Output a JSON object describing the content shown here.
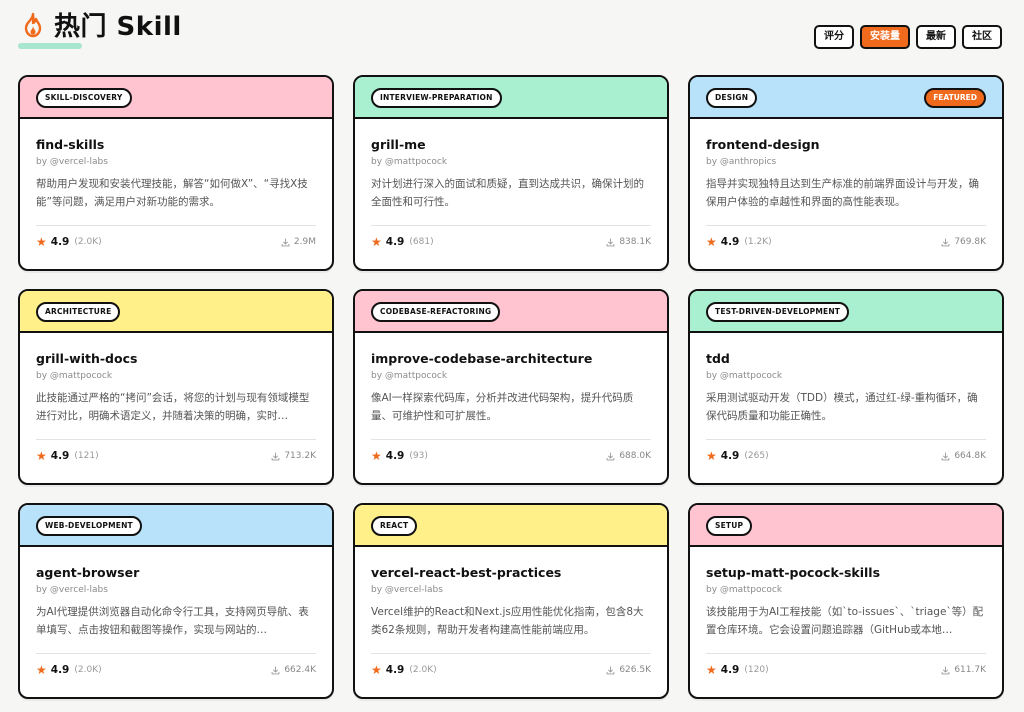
{
  "header": {
    "title": "热门 Skill",
    "sort_options": [
      {
        "label": "评分",
        "active": false
      },
      {
        "label": "安装量",
        "active": true
      },
      {
        "label": "最新",
        "active": false
      },
      {
        "label": "社区",
        "active": false
      }
    ]
  },
  "colors": {
    "accent": "#f06a1d",
    "pink": "#ffc4cf",
    "mint": "#a8f0cf",
    "blue": "#b8e2fa",
    "yellow": "#fff08a"
  },
  "cards": [
    {
      "tag": "SKILL-DISCOVERY",
      "head_color": "#ffc4cf",
      "featured": "",
      "name": "find-skills",
      "author": "by @vercel-labs",
      "desc": "帮助用户发现和安装代理技能，解答“如何做X”、“寻找X技能”等问题，满足用户对新功能的需求。",
      "rating": "4.9",
      "rating_count": "(2.0K)",
      "installs": "2.9M"
    },
    {
      "tag": "INTERVIEW-PREPARATION",
      "head_color": "#a8f0cf",
      "featured": "",
      "name": "grill-me",
      "author": "by @mattpocock",
      "desc": "对计划进行深入的面试和质疑，直到达成共识，确保计划的全面性和可行性。",
      "rating": "4.9",
      "rating_count": "(681)",
      "installs": "838.1K"
    },
    {
      "tag": "DESIGN",
      "head_color": "#b8e2fa",
      "featured": "FEATURED",
      "name": "frontend-design",
      "author": "by @anthropics",
      "desc": "指导并实现独特且达到生产标准的前端界面设计与开发，确保用户体验的卓越性和界面的高性能表现。",
      "rating": "4.9",
      "rating_count": "(1.2K)",
      "installs": "769.8K"
    },
    {
      "tag": "ARCHITECTURE",
      "head_color": "#fff08a",
      "featured": "",
      "name": "grill-with-docs",
      "author": "by @mattpocock",
      "desc": "此技能通过严格的“拷问”会话，将您的计划与现有领域模型进行对比，明确术语定义，并随着决策的明确，实时…",
      "rating": "4.9",
      "rating_count": "(121)",
      "installs": "713.2K"
    },
    {
      "tag": "CODEBASE-REFACTORING",
      "head_color": "#ffc4cf",
      "featured": "",
      "name": "improve-codebase-architecture",
      "author": "by @mattpocock",
      "desc": "像AI一样探索代码库，分析并改进代码架构，提升代码质量、可维护性和可扩展性。",
      "rating": "4.9",
      "rating_count": "(93)",
      "installs": "688.0K"
    },
    {
      "tag": "TEST-DRIVEN-DEVELOPMENT",
      "head_color": "#a8f0cf",
      "featured": "",
      "name": "tdd",
      "author": "by @mattpocock",
      "desc": "采用测试驱动开发（TDD）模式，通过红-绿-重构循环，确保代码质量和功能正确性。",
      "rating": "4.9",
      "rating_count": "(265)",
      "installs": "664.8K"
    },
    {
      "tag": "WEB-DEVELOPMENT",
      "head_color": "#b8e2fa",
      "featured": "",
      "name": "agent-browser",
      "author": "by @vercel-labs",
      "desc": "为AI代理提供浏览器自动化命令行工具，支持网页导航、表单填写、点击按钮和截图等操作，实现与网站的…",
      "rating": "4.9",
      "rating_count": "(2.0K)",
      "installs": "662.4K"
    },
    {
      "tag": "REACT",
      "head_color": "#fff08a",
      "featured": "",
      "name": "vercel-react-best-practices",
      "author": "by @vercel-labs",
      "desc": "Vercel维护的React和Next.js应用性能优化指南，包含8大类62条规则，帮助开发者构建高性能前端应用。",
      "rating": "4.9",
      "rating_count": "(2.0K)",
      "installs": "626.5K"
    },
    {
      "tag": "SETUP",
      "head_color": "#ffc4cf",
      "featured": "",
      "name": "setup-matt-pocock-skills",
      "author": "by @mattpocock",
      "desc": "该技能用于为AI工程技能（如`to-issues`、`triage`等）配置仓库环境。它会设置问题追踪器（GitHub或本地…",
      "rating": "4.9",
      "rating_count": "(120)",
      "installs": "611.7K"
    }
  ]
}
